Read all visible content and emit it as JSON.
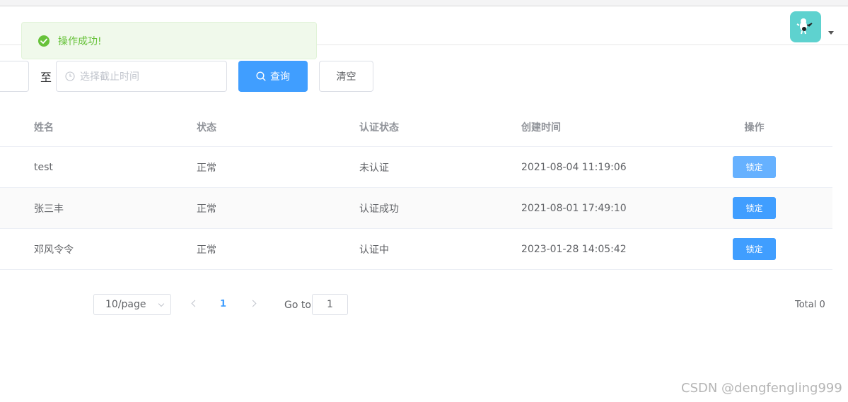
{
  "toast": {
    "message": "操作成功!",
    "icon": "success-check-icon",
    "color": "#67c23a"
  },
  "header": {
    "avatar_icon": "user-avatar-icon",
    "dropdown_icon": "caret-down-icon"
  },
  "search": {
    "range_separator": "至",
    "end_time_placeholder": "选择截止时间",
    "query_label": "查询",
    "clear_label": "清空"
  },
  "table": {
    "columns": [
      "姓名",
      "状态",
      "认证状态",
      "创建时间",
      "操作"
    ],
    "rows": [
      {
        "name": "test",
        "status": "正常",
        "auth_status": "未认证",
        "created": "2021-08-04 11:19:06",
        "action": "锁定"
      },
      {
        "name": "张三丰",
        "status": "正常",
        "auth_status": "认证成功",
        "created": "2021-08-01 17:49:10",
        "action": "锁定"
      },
      {
        "name": "邓风令令",
        "status": "正常",
        "auth_status": "认证中",
        "created": "2023-01-28 14:05:42",
        "action": "锁定"
      }
    ]
  },
  "pagination": {
    "page_size": "10/page",
    "current_page": "1",
    "goto_label": "Go to",
    "goto_value": "1",
    "total": "Total 0"
  },
  "watermark": "CSDN @dengfengling999",
  "colors": {
    "primary": "#409eff",
    "primary_light": "#66b1ff",
    "avatar_bg": "#5ed2cf"
  }
}
